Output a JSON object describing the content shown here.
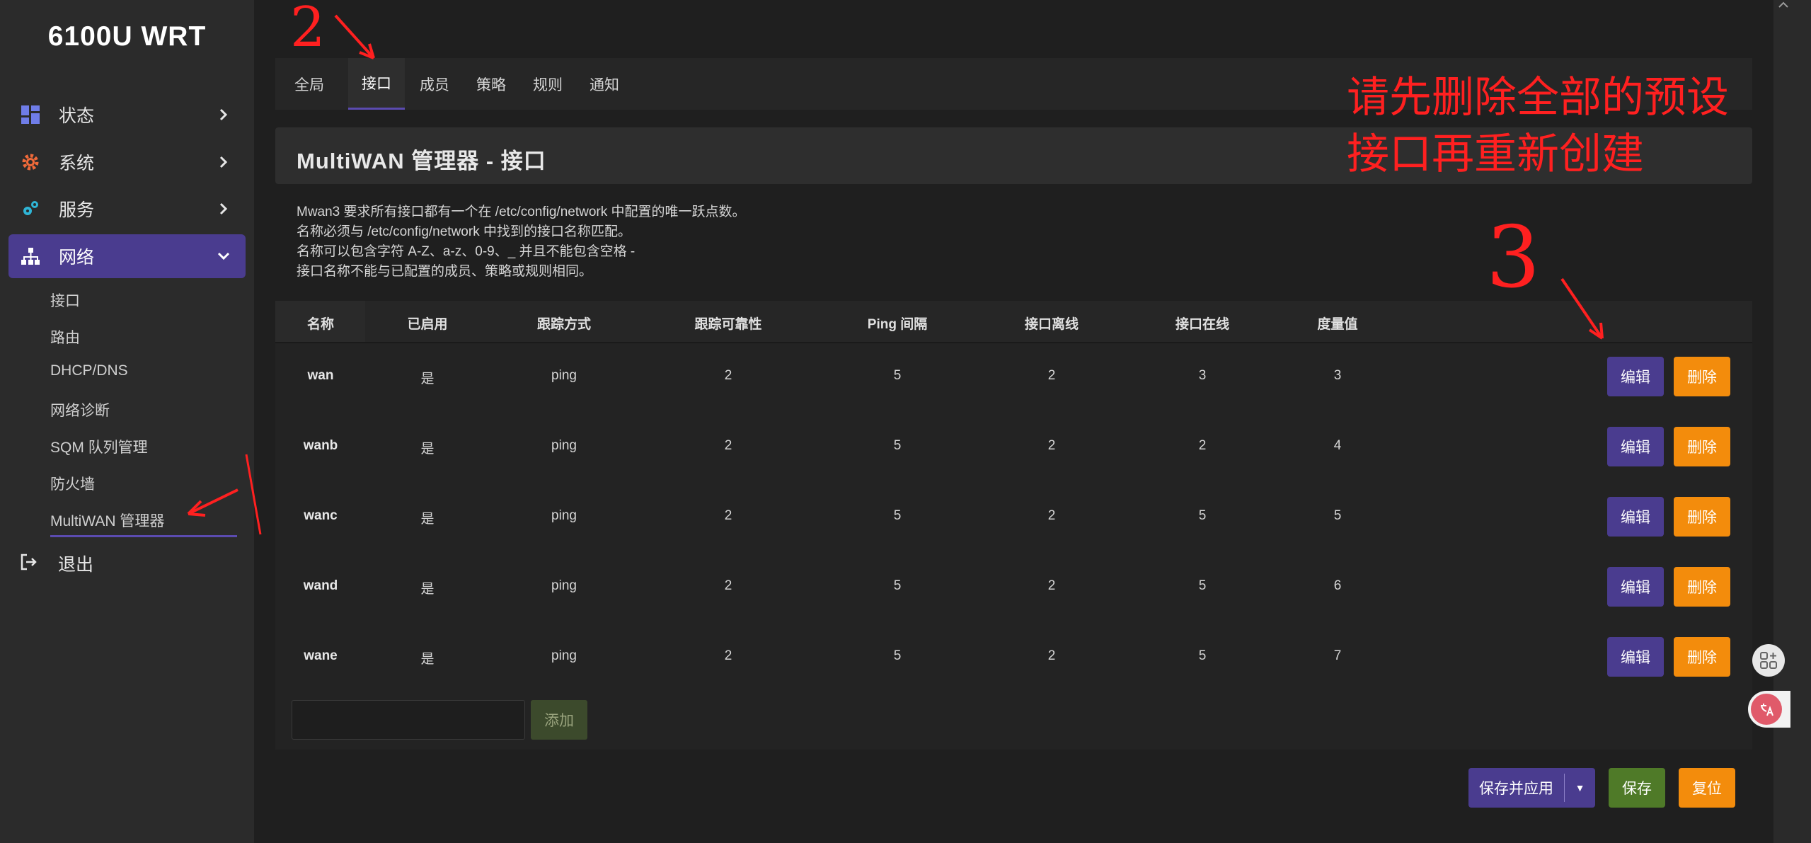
{
  "brand": "6100U WRT",
  "sidebar": {
    "items": [
      {
        "label": "状态",
        "icon": "dashboard-icon"
      },
      {
        "label": "系统",
        "icon": "gear-icon"
      },
      {
        "label": "服务",
        "icon": "cogs-icon"
      },
      {
        "label": "网络",
        "icon": "network-icon"
      }
    ],
    "sub_items": [
      "接口",
      "路由",
      "DHCP/DNS",
      "网络诊断",
      "SQM 队列管理",
      "防火墙",
      "MultiWAN 管理器"
    ],
    "logout": "退出"
  },
  "tabs": [
    "全局",
    "接口",
    "成员",
    "策略",
    "规则",
    "通知"
  ],
  "active_tab": "接口",
  "page_title": "MultiWAN 管理器 - 接口",
  "description": [
    "Mwan3 要求所有接口都有一个在 /etc/config/network 中配置的唯一跃点数。",
    "名称必须与 /etc/config/network 中找到的接口名称匹配。",
    "名称可以包含字符 A-Z、a-z、0-9、_ 并且不能包含空格 -",
    "接口名称不能与已配置的成员、策略或规则相同。"
  ],
  "table": {
    "headers": [
      "名称",
      "已启用",
      "跟踪方式",
      "跟踪可靠性",
      "Ping 间隔",
      "接口离线",
      "接口在线",
      "度量值"
    ],
    "rows": [
      [
        "wan",
        "是",
        "ping",
        "2",
        "5",
        "2",
        "3",
        "3"
      ],
      [
        "wanb",
        "是",
        "ping",
        "2",
        "5",
        "2",
        "2",
        "4"
      ],
      [
        "wanc",
        "是",
        "ping",
        "2",
        "5",
        "2",
        "5",
        "5"
      ],
      [
        "wand",
        "是",
        "ping",
        "2",
        "5",
        "2",
        "5",
        "6"
      ],
      [
        "wane",
        "是",
        "ping",
        "2",
        "5",
        "2",
        "5",
        "7"
      ]
    ],
    "edit_label": "编辑",
    "delete_label": "删除"
  },
  "add": {
    "placeholder": "",
    "button": "添加"
  },
  "footer": {
    "save_apply": "保存并应用",
    "save": "保存",
    "reset": "复位"
  },
  "annotations": {
    "num2": "2",
    "num3": "3",
    "note_line1": "请先删除全部的预设",
    "note_line2": "接口再重新创建"
  },
  "colors": {
    "accent": "#4a3c8f",
    "danger": "#f38c0c",
    "save": "#4f7a28",
    "annotation": "#ff2020"
  }
}
